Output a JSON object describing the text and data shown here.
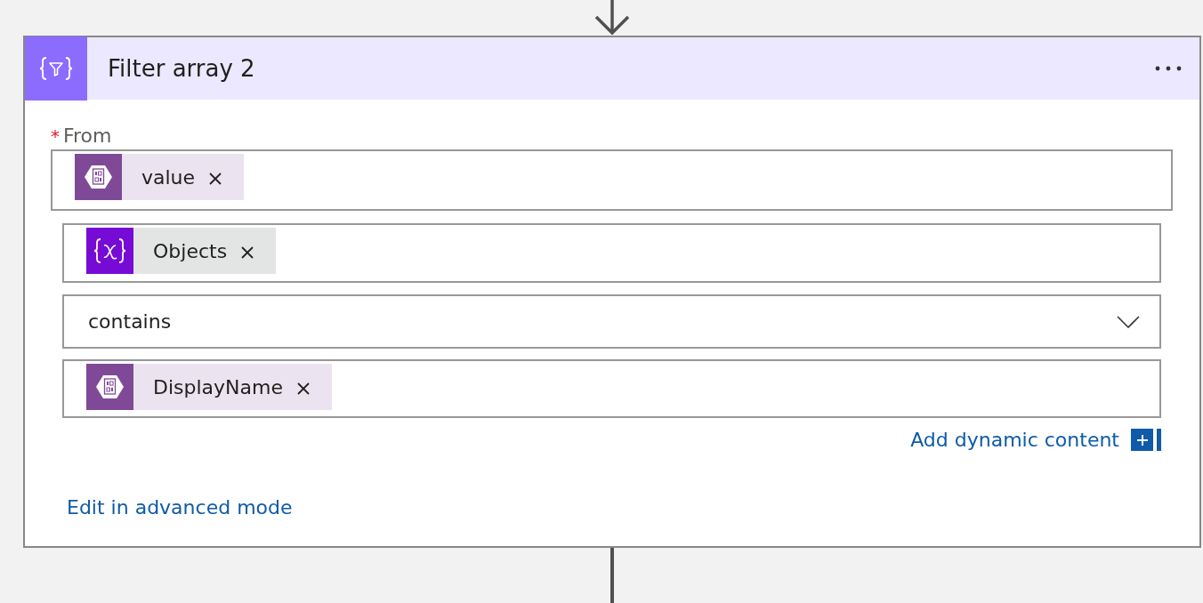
{
  "action": {
    "title": "Filter array 2"
  },
  "from": {
    "required_mark": "*",
    "label": "From",
    "tokens": [
      {
        "kind": "dynamic",
        "label": "value"
      }
    ]
  },
  "condition": {
    "left": {
      "tokens": [
        {
          "kind": "variable",
          "label": "Objects"
        }
      ]
    },
    "operator": {
      "value": "contains"
    },
    "right": {
      "tokens": [
        {
          "kind": "dynamic",
          "label": "DisplayName"
        }
      ]
    }
  },
  "add_dynamic_content": {
    "label": "Add dynamic content"
  },
  "advanced_mode_link": {
    "label": "Edit in advanced mode"
  }
}
